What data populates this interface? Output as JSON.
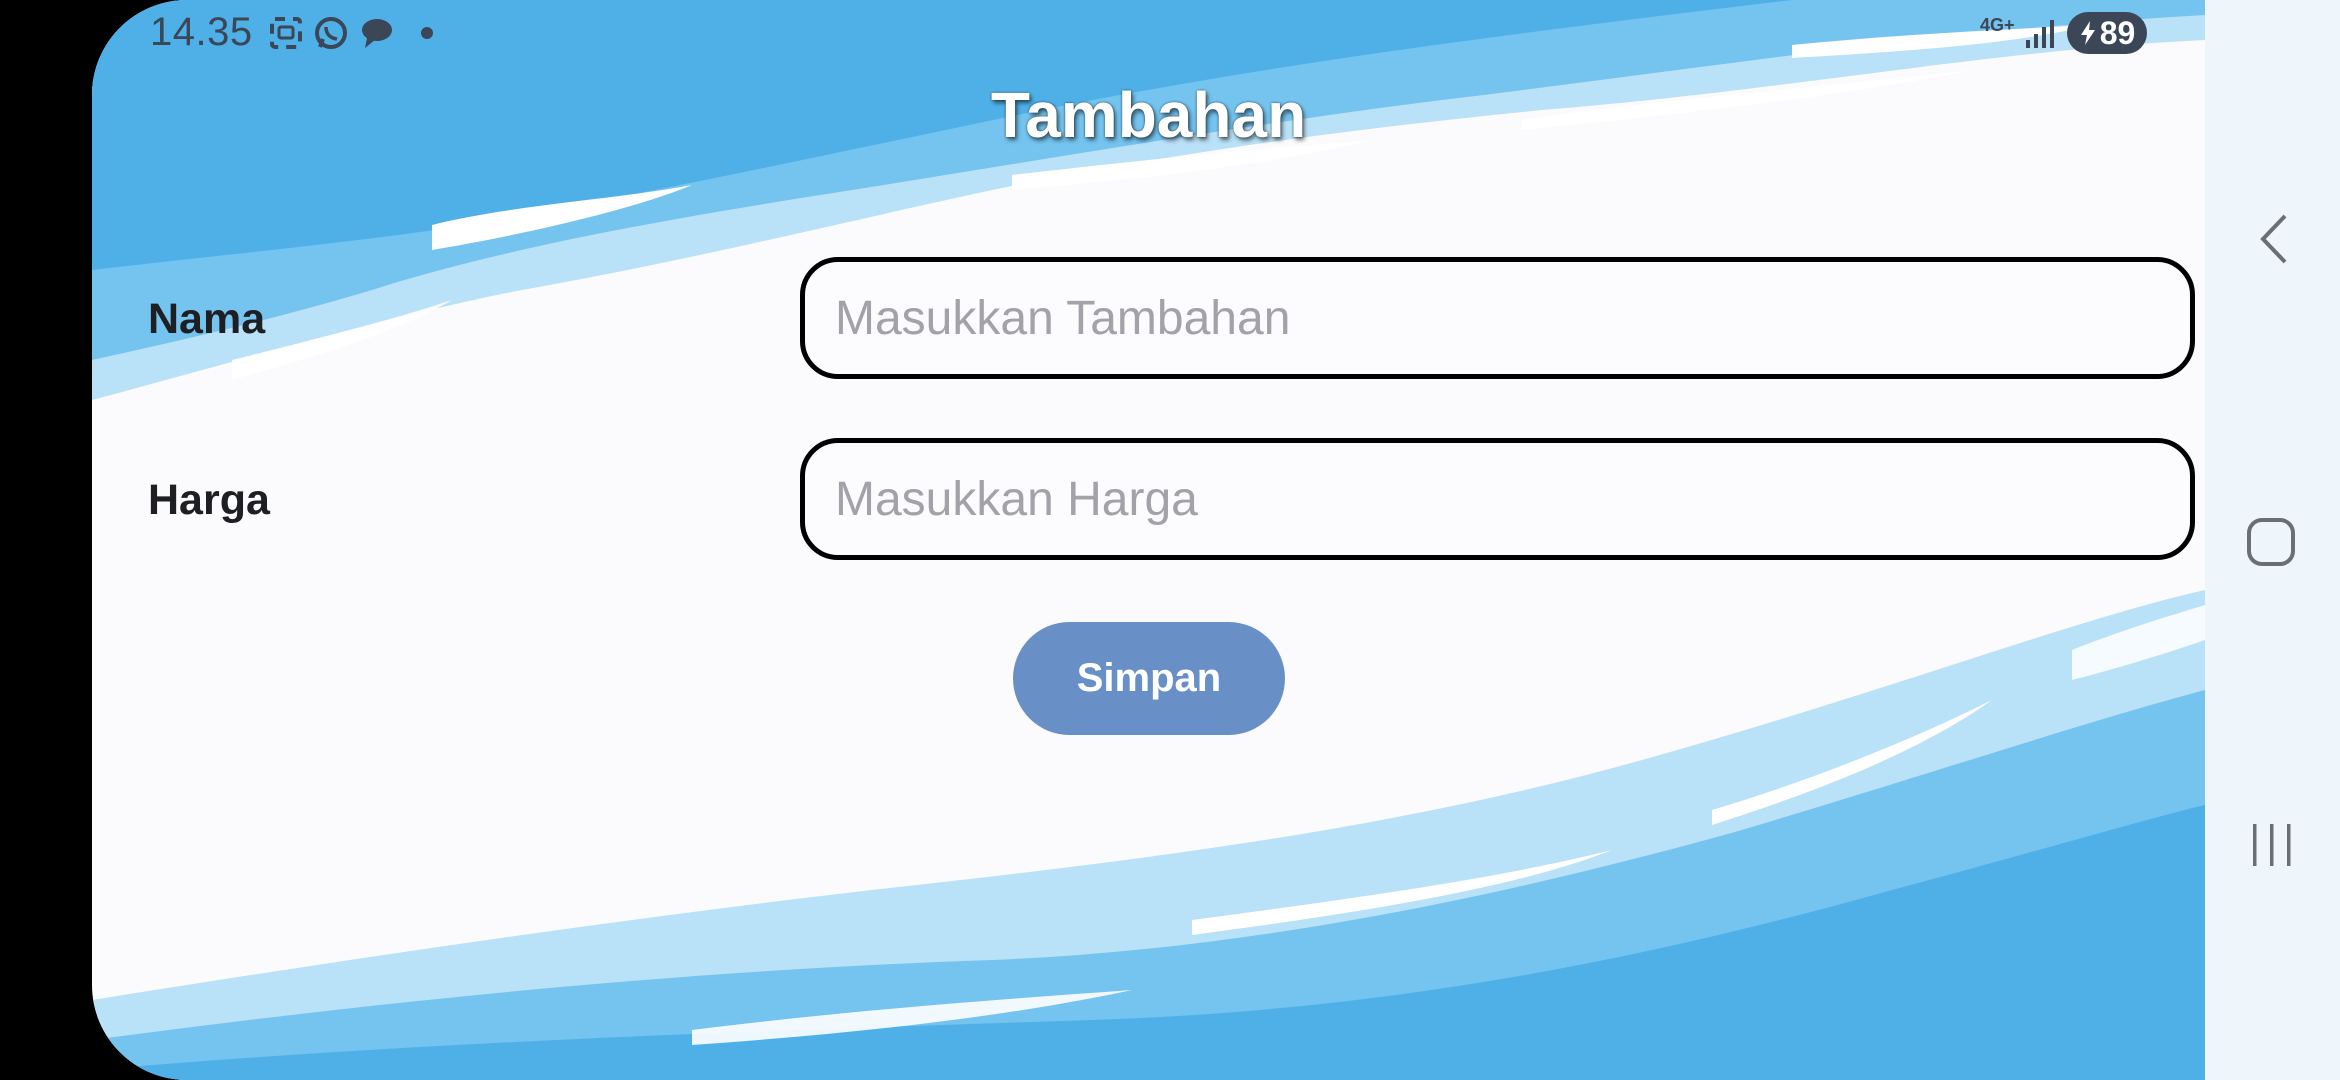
{
  "status_bar": {
    "time": "14.35",
    "network": "4G+",
    "battery": "89",
    "icons": [
      "screenshot-icon",
      "whatsapp-icon",
      "chat-bubble-icon",
      "dot-icon",
      "signal-icon",
      "battery-charging-icon"
    ]
  },
  "page": {
    "title": "Tambahan"
  },
  "form": {
    "nama_label": "Nama",
    "nama_placeholder": "Masukkan Tambahan",
    "harga_label": "Harga",
    "harga_placeholder": "Masukkan Harga",
    "save_label": "Simpan"
  },
  "nav_bar": {
    "icons": [
      "back-icon",
      "home-icon",
      "recents-icon"
    ]
  },
  "colors": {
    "button": "#6990c6",
    "water_dark": "#4fb0e8",
    "water_light": "#b9e1f7",
    "background": "#fbfafc"
  }
}
